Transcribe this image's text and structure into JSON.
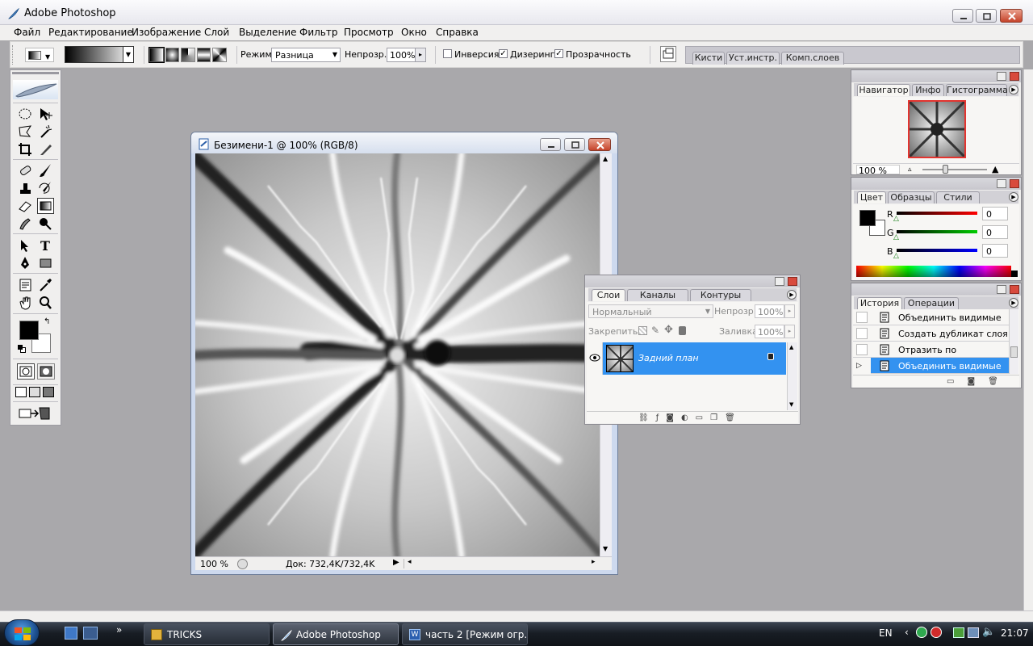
{
  "app": {
    "title": "Adobe Photoshop"
  },
  "menu": [
    {
      "label": "Файл"
    },
    {
      "label": "Редактирование"
    },
    {
      "label": "Изображение"
    },
    {
      "label": "Слой"
    },
    {
      "label": "Выделение"
    },
    {
      "label": "Фильтр"
    },
    {
      "label": "Просмотр"
    },
    {
      "label": "Окно"
    },
    {
      "label": "Справка"
    }
  ],
  "options": {
    "mode_label": "Режим:",
    "mode_value": "Разница",
    "opacity_label": "Непрозр.:",
    "opacity_value": "100%",
    "invert_label": "Инверсия",
    "dither_label": "Дизеринг",
    "transparency_label": "Прозрачность",
    "invert_checked": false,
    "dither_checked": true,
    "transparency_checked": true,
    "well_tabs": [
      "Кисти",
      "Уст.инстр.",
      "Комп.слоев"
    ]
  },
  "document": {
    "title": "Безимени-1 @ 100% (RGB/8)",
    "zoom": "100 %",
    "doc_info": "Док: 732,4K/732,4K"
  },
  "navigator": {
    "tabs": [
      "Навигатор",
      "Инфо",
      "Гистограмма"
    ],
    "zoom": "100 %",
    "zoom_level": 0.35
  },
  "color": {
    "tabs": [
      "Цвет",
      "Образцы",
      "Стили"
    ],
    "channels": [
      {
        "label": "R",
        "value": "0",
        "color": "#ff0000"
      },
      {
        "label": "G",
        "value": "0",
        "color": "#00cc00"
      },
      {
        "label": "B",
        "value": "0",
        "color": "#0000ff"
      }
    ],
    "foreground": "#000000",
    "background": "#ffffff"
  },
  "layers": {
    "tabs": [
      "Слои",
      "Каналы",
      "Контуры"
    ],
    "blend_mode": "Нормальный",
    "opacity_label": "Непрозр.:",
    "opacity_value": "100%",
    "lock_label": "Закрепить:",
    "fill_label": "Заливка:",
    "fill_value": "100%",
    "layer_name": "Задний план"
  },
  "history": {
    "tabs": [
      "История",
      "Операции"
    ],
    "items": [
      {
        "label": "Объединить видимые"
      },
      {
        "label": "Создать дубликат слоя"
      },
      {
        "label": "Отразить по горизонтали"
      },
      {
        "label": "Объединить видимые"
      }
    ],
    "selected_index": 3
  },
  "taskbar": {
    "items": [
      {
        "label": "TRICKS"
      },
      {
        "label": "Adobe Photoshop"
      },
      {
        "label": "часть 2 [Режим огр..."
      }
    ],
    "lang": "EN",
    "time": "21:07"
  },
  "colors": {
    "selection_blue": "#3392f0",
    "close_red": "#c5432a",
    "workspace": "#a9a8ab"
  }
}
